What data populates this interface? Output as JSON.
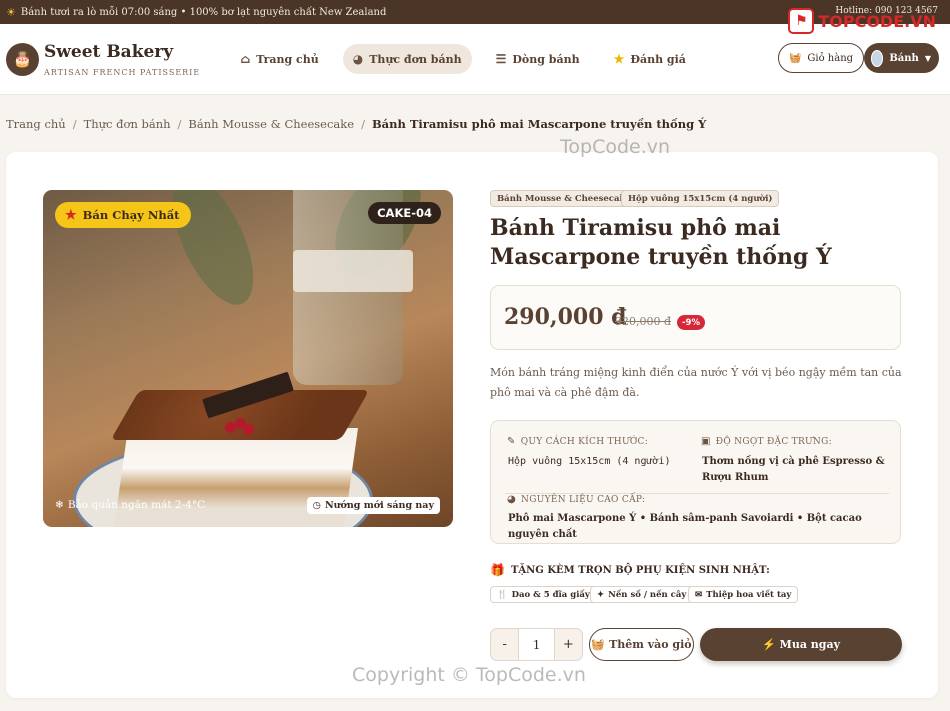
{
  "topbar": {
    "announcement": "Bánh tươi ra lò mỗi 07:00 sáng • 100% bơ lạt nguyên chất New Zealand",
    "hotline": "Hotline: 090 123 4567",
    "watermark_brand": "TOPCODE.VN"
  },
  "nav": {
    "brand_name": "Sweet Bakery",
    "brand_tagline": "ARTISAN FRENCH PATISSERIE",
    "items": [
      {
        "label": "Trang chủ",
        "icon": "home-icon"
      },
      {
        "label": "Thực đơn bánh",
        "icon": "cookie-icon",
        "active": true
      },
      {
        "label": "Dòng bánh",
        "icon": "layers-icon"
      },
      {
        "label": "Đánh giá",
        "icon": "star-icon"
      }
    ],
    "cart_label": "Giỏ hàng",
    "user_label": "Bánh"
  },
  "breadcrumb": [
    "Trang chủ",
    "Thực đơn bánh",
    "Bánh Mousse & Cheesecake",
    "Bánh Tiramisu phô mai Mascarpone truyền thống Ý"
  ],
  "product": {
    "badge": "Bán Chạy Nhất",
    "code": "CAKE-04",
    "storage_note": "Bảo quản ngăn mát 2-4°C",
    "fresh_note": "Nướng mới sáng nay",
    "tags": [
      "Bánh Mousse & Cheesecake",
      "Hộp vuông 15x15cm (4 người)"
    ],
    "title": "Bánh Tiramisu phô mai Mascarpone truyền thống Ý",
    "price": "290,000 đ",
    "old_price": "320,000 đ",
    "discount": "-9%",
    "description": "Món bánh tráng miệng kinh điển của nước Ý với vị béo ngậy mềm tan của phô mai và cà phê đậm đà.",
    "specs": {
      "size_label": "QUY CÁCH KÍCH THƯỚC:",
      "size_value": "Hộp vuông 15x15cm (4 người)",
      "sweet_label": "ĐỘ NGỌT ĐẶC TRƯNG:",
      "sweet_value": "Thơm nồng vị cà phê Espresso & Rượu Rhum",
      "ingredients_label": "NGUYÊN LIỆU CAO CẤP:",
      "ingredients_value": "Phô mai Mascarpone Ý • Bánh sâm-panh Savoiardi • Bột cacao nguyên chất"
    },
    "gift_title": "TẶNG KÈM TRỌN BỘ PHỤ KIỆN SINH NHẬT:",
    "gifts": [
      "Dao & 5 đĩa giấy",
      "Nến số / nến cây",
      "Thiệp hoa viết tay"
    ],
    "quantity": "1",
    "add_to_cart": "Thêm vào giỏ",
    "buy_now": "Mua ngay"
  },
  "watermarks": [
    "TopCode.vn",
    "Copyright © TopCode.vn"
  ],
  "colors": {
    "primary": "#5a4232",
    "accent": "#f5c518",
    "sale": "#d62839",
    "topbar": "#4a3527"
  }
}
